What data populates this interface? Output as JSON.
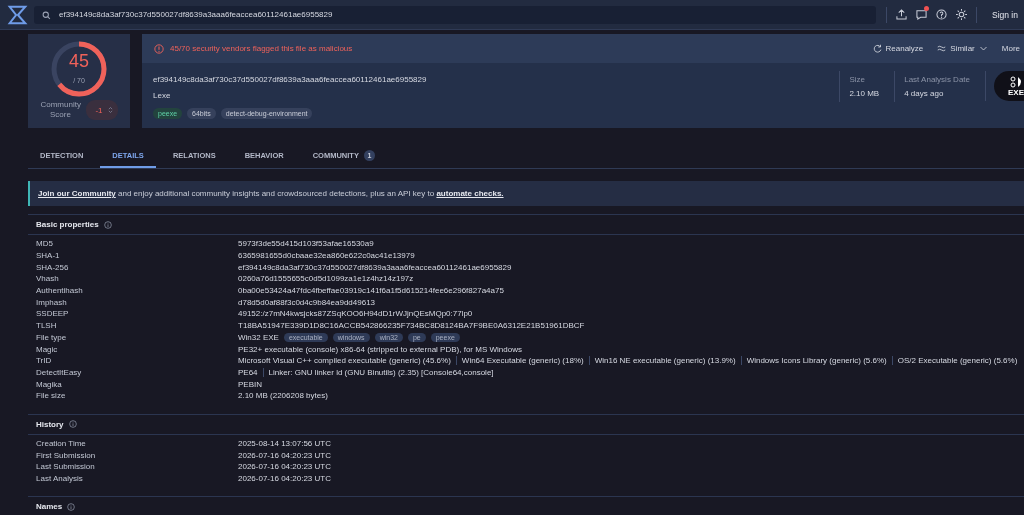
{
  "header": {
    "search_value": "ef394149c8da3af730c37d550027df8639a3aaa6feaccea60112461ae6955829",
    "notification_dot": true,
    "sign_in": "Sign in"
  },
  "score": {
    "detections": "45",
    "total": "/ 70",
    "level": 0.64,
    "community_label": "Community Score",
    "community_value": "-1"
  },
  "summary": {
    "alert": "45/70 security vendors flagged this file as malicious",
    "actions": [
      {
        "label": "Reanalyze",
        "kind": "reanalyze"
      },
      {
        "label": "Similar",
        "kind": "similar"
      },
      {
        "label": "More",
        "kind": "plain"
      }
    ],
    "hash": "ef394149c8da3af730c37d550027df8639a3aaa6feaccea60112461ae6955829",
    "name": "Lexe",
    "tags": [
      {
        "label": "peexe",
        "kind": "highlight"
      },
      {
        "label": "64bits",
        "kind": "plain"
      },
      {
        "label": "detect-debug-environment",
        "kind": "plain"
      }
    ],
    "stats": [
      {
        "label": "Size",
        "value": "2.10 MB"
      },
      {
        "label": "Last Analysis Date",
        "value": "4 days ago"
      }
    ],
    "file_badge": "EXE"
  },
  "tabs": [
    {
      "label": "DETECTION",
      "selected": false
    },
    {
      "label": "DETAILS",
      "selected": true
    },
    {
      "label": "RELATIONS",
      "selected": false
    },
    {
      "label": "BEHAVIOR",
      "selected": false
    },
    {
      "label": "COMMUNITY",
      "selected": false,
      "count": "1"
    }
  ],
  "banner": [
    {
      "kind": "link",
      "text": "Join our Community"
    },
    {
      "kind": "text",
      "text": " and enjoy additional community insights and crowdsourced detections, plus an API key to "
    },
    {
      "kind": "link",
      "text": "automate checks."
    }
  ],
  "sections": [
    {
      "title": "Basic properties",
      "rows": [
        {
          "label": "MD5",
          "values": [
            "5973f3de55d415d103f53afae16530a9"
          ]
        },
        {
          "label": "SHA-1",
          "values": [
            "6365981655d0cbaae32ea860e622c0ac41e13979"
          ]
        },
        {
          "label": "SHA-256",
          "values": [
            "ef394149c8da3af730c37d550027df8639a3aaa6feaccea60112461ae6955829"
          ]
        },
        {
          "label": "Vhash",
          "values": [
            "0260a76d1555655c0d5d1099za1e1z4hz14z197z"
          ]
        },
        {
          "label": "Authentihash",
          "values": [
            "0ba00e53424a47fdc4fbeffae03919c141f6a1f5d615214fee6e296f827a4a75"
          ]
        },
        {
          "label": "Imphash",
          "values": [
            "d78d5d0af88f3c0d4c9b84ea9dd49613"
          ]
        },
        {
          "label": "SSDEEP",
          "values": [
            "49152:/z7mN4kwsjcks87ZSqKOO6H94dD1rWJjnQEsMQp0:77lp0"
          ]
        },
        {
          "label": "TLSH",
          "values": [
            "T18BA51947E339D1D8C16ACCB542866235F734BC8D8124BA7F9BE0A6312E21B51961DBCF"
          ]
        },
        {
          "label": "File type",
          "values": [
            "Win32 EXE"
          ],
          "tags": [
            "executable",
            "windows",
            "win32",
            "pe",
            "peexe"
          ]
        },
        {
          "label": "Magic",
          "values": [
            "PE32+ executable (console) x86-64 (stripped to external PDB), for MS Windows"
          ]
        },
        {
          "label": "TrID",
          "values": [
            "Microsoft Visual C++ compiled executable (generic) (45.6%)",
            "Win64 Executable (generic) (18%)",
            "Win16 NE executable (generic) (13.9%)",
            "Windows Icons Library (generic) (5.6%)",
            "OS/2 Executable (generic) (5.6%)"
          ]
        },
        {
          "label": "DetectItEasy",
          "values": [
            "PE64",
            "Linker: GNU linker ld (GNU Binutils) (2.35) [Console64,console]"
          ]
        },
        {
          "label": "Magika",
          "values": [
            "PEBIN"
          ]
        },
        {
          "label": "File size",
          "values": [
            "2.10 MB (2206208 bytes)"
          ]
        }
      ]
    },
    {
      "title": "History",
      "rows": [
        {
          "label": "Creation Time",
          "values": [
            "2025-08-14 13:07:56 UTC"
          ]
        },
        {
          "label": "First Submission",
          "values": [
            "2026-07-16 04:20:23 UTC"
          ]
        },
        {
          "label": "Last Submission",
          "values": [
            "2026-07-16 04:20:23 UTC"
          ]
        },
        {
          "label": "Last Analysis",
          "values": [
            "2026-07-16 04:20:23 UTC"
          ]
        }
      ]
    },
    {
      "title": "Names"
    }
  ]
}
